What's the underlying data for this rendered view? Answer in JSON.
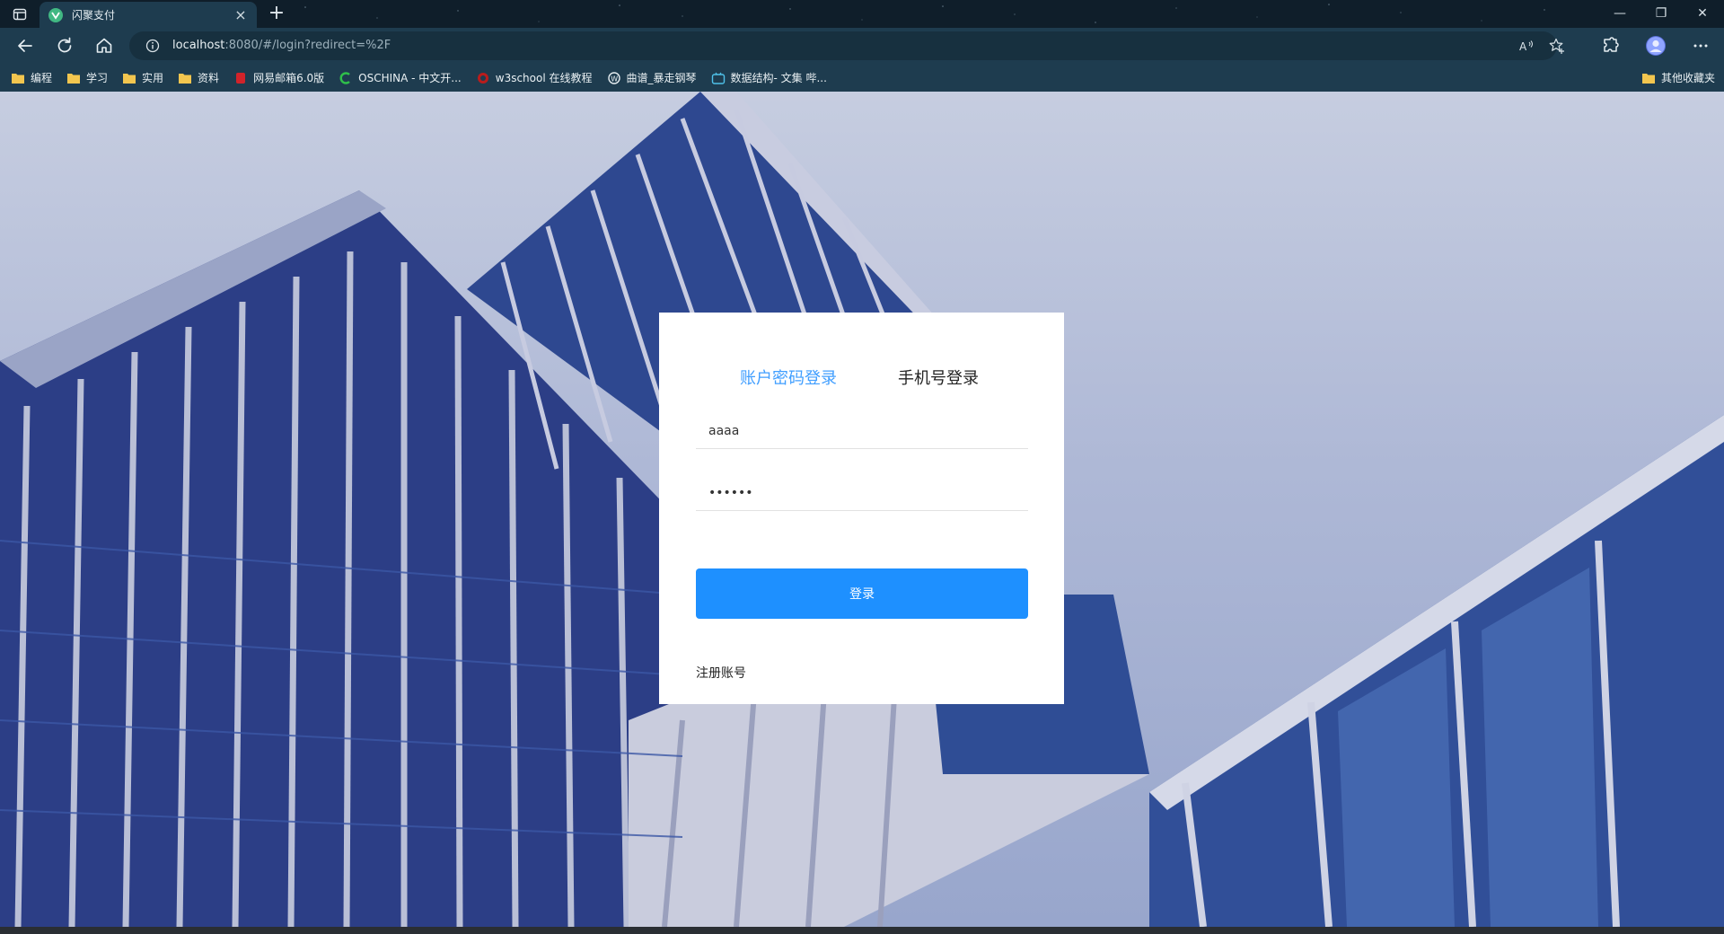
{
  "browser": {
    "tab_title": "闪聚支付",
    "new_tab": "+",
    "window_controls": {
      "minimize": "—",
      "restore": "❐",
      "close": "✕"
    },
    "address_host": "localhost",
    "address_rest": ":8080/#/login?redirect=%2F",
    "icons": [
      "back-icon",
      "refresh-icon",
      "home-icon",
      "info-icon",
      "read-aloud-icon",
      "favorite-add-icon",
      "extensions-icon",
      "profile-icon",
      "more-icon"
    ]
  },
  "bookmarks": {
    "items": [
      {
        "label": "编程",
        "icon": "folder"
      },
      {
        "label": "学习",
        "icon": "folder"
      },
      {
        "label": "实用",
        "icon": "folder"
      },
      {
        "label": "资料",
        "icon": "folder"
      },
      {
        "label": "网易邮箱6.0版",
        "icon": "netease"
      },
      {
        "label": "OSCHINA - 中文开...",
        "icon": "oschina"
      },
      {
        "label": "w3school 在线教程",
        "icon": "w3school"
      },
      {
        "label": "曲谱_暴走钢琴",
        "icon": "wordpress"
      },
      {
        "label": "数据结构- 文集 哔...",
        "icon": "bilibili"
      }
    ],
    "other": "其他收藏夹"
  },
  "login": {
    "tab_account": "账户密码登录",
    "tab_phone": "手机号登录",
    "username_value": "aaaa",
    "password_value": "123456",
    "submit_label": "登录",
    "register_link": "注册账号"
  },
  "colors": {
    "accent": "#409eff",
    "button": "#1e90ff",
    "chrome": "#1e3c4f"
  }
}
